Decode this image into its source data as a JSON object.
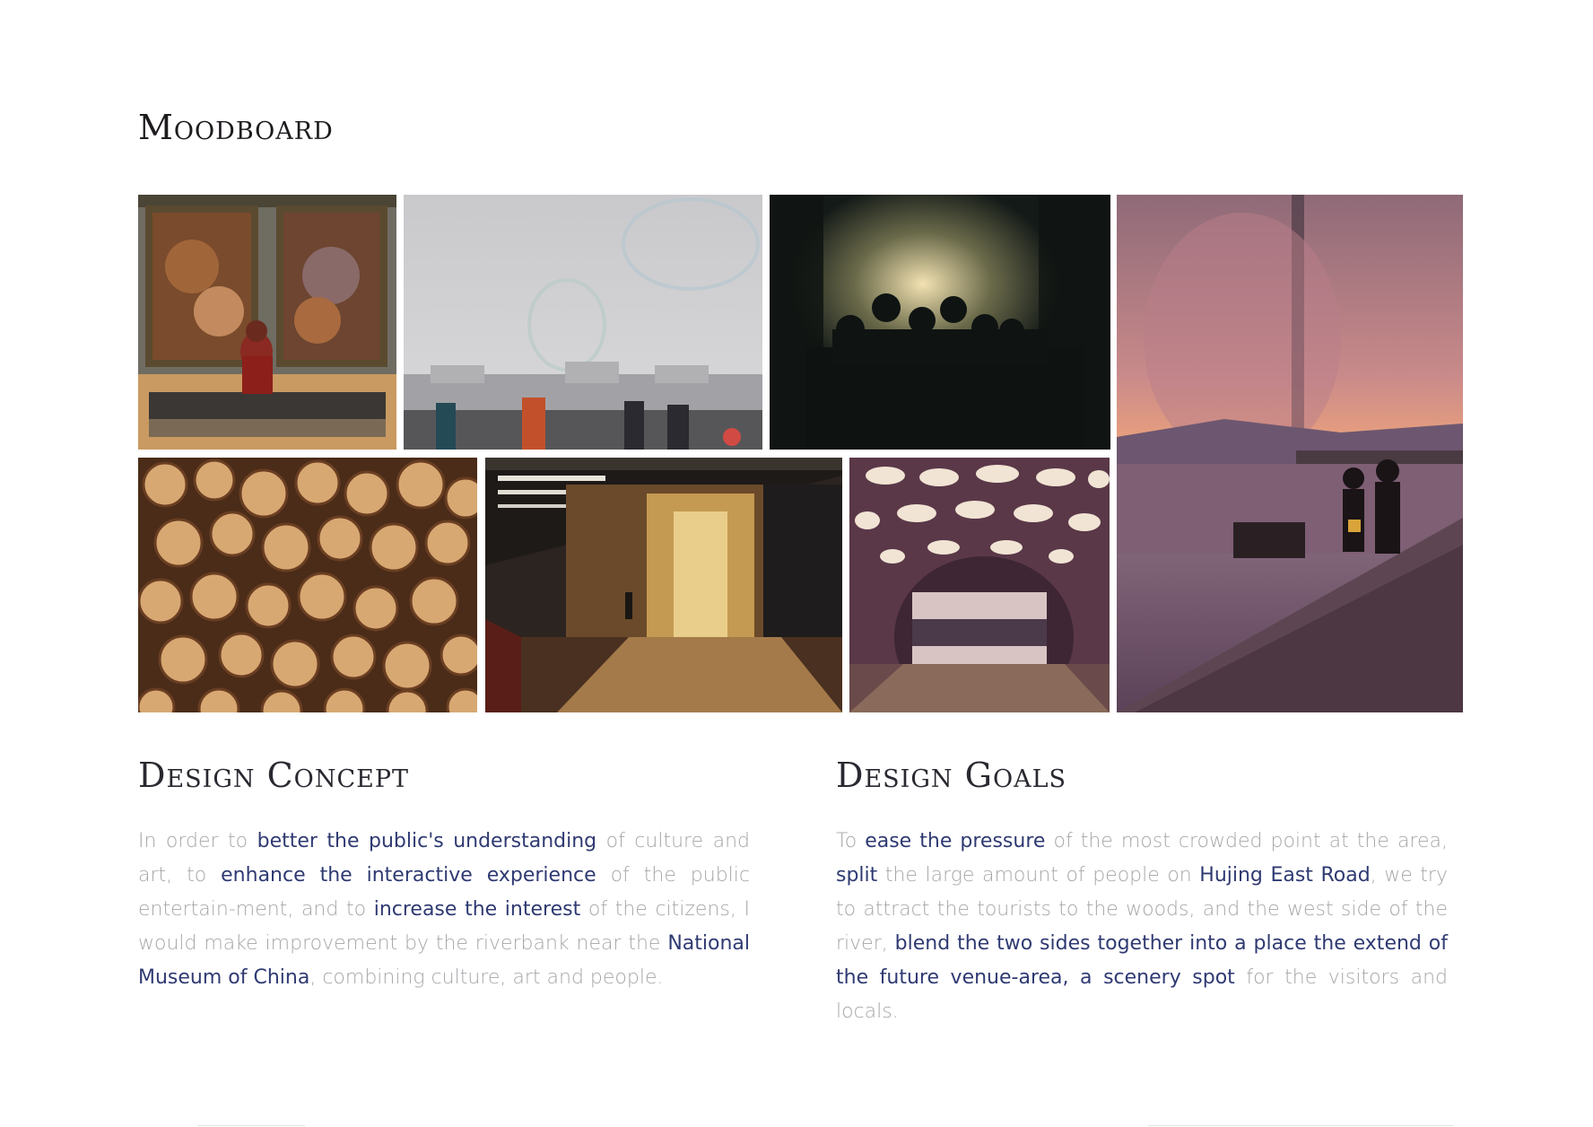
{
  "moodboard": {
    "title": "Moodboard"
  },
  "images": [
    {
      "name": "gallery-paintings-photo"
    },
    {
      "name": "bubbles-city-photo"
    },
    {
      "name": "forest-sunset-crowd-photo"
    },
    {
      "name": "fountain-pier-couple-photo"
    },
    {
      "name": "firewood-stack-photo"
    },
    {
      "name": "glass-corridor-photo"
    },
    {
      "name": "wooden-lattice-tunnel-photo"
    }
  ],
  "concept": {
    "title": "Design Concept",
    "segments": [
      {
        "text": "In order to ",
        "hl": false
      },
      {
        "text": "better the public's understanding",
        "hl": true
      },
      {
        "text": " of culture and art, to ",
        "hl": false
      },
      {
        "text": "enhance the interactive experience",
        "hl": true
      },
      {
        "text": " of the public entertain-ment, and to ",
        "hl": false
      },
      {
        "text": "increase the interest",
        "hl": true
      },
      {
        "text": " of the citizens, I would make improvement by the riverbank near the ",
        "hl": false
      },
      {
        "text": "National Museum of China",
        "hl": true
      },
      {
        "text": ", combining culture, art and people.",
        "hl": false
      }
    ]
  },
  "goals": {
    "title": "Design Goals",
    "segments": [
      {
        "text": "To ",
        "hl": false
      },
      {
        "text": "ease the pressure",
        "hl": true
      },
      {
        "text": " of the most crowded point at the area, ",
        "hl": false
      },
      {
        "text": "split",
        "hl": true
      },
      {
        "text": " the large amount of people on ",
        "hl": false
      },
      {
        "text": "Hujing East Road",
        "hl": true
      },
      {
        "text": ", we try to attract the tourists to the woods, and the west side of the river, ",
        "hl": false
      },
      {
        "text": "blend the two sides together into a place the extend of the future venue-area, a scenery spot",
        "hl": true
      },
      {
        "text": " for the visitors and locals.",
        "hl": false
      }
    ]
  },
  "colors": {
    "highlight": "#2f3a72",
    "body_text": "#a7a7ab",
    "heading": "#1e1b1f"
  }
}
